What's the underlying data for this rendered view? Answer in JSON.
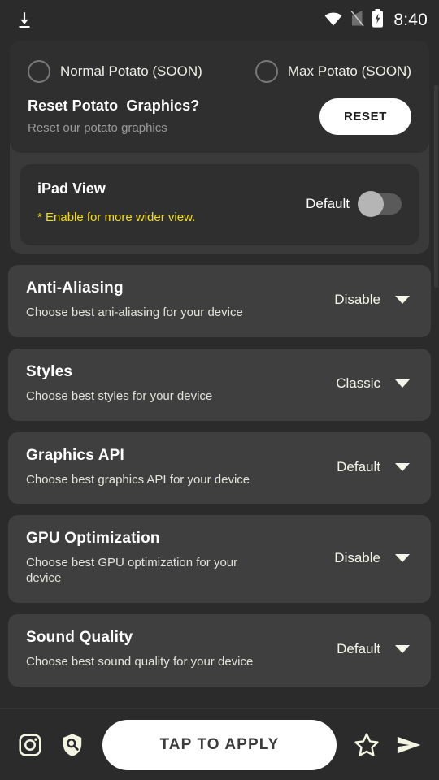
{
  "statusbar": {
    "time": "8:40",
    "icons": [
      "download-icon",
      "wifi-icon",
      "signal-off-icon",
      "battery-charging-icon"
    ]
  },
  "potato_group": {
    "radios": [
      {
        "label": "Normal Potato (SOON)",
        "selected": false
      },
      {
        "label": "Max Potato (SOON)",
        "selected": false
      }
    ],
    "reset": {
      "title": "Reset Potato  Graphics?",
      "subtitle": "Reset our potato graphics",
      "button_label": "RESET"
    }
  },
  "ipad_view": {
    "title": "iPad View",
    "note": "* Enable for more wider view.",
    "note_color": "#f2dd1a",
    "toggle_label": "Default",
    "toggle_on": false
  },
  "settings": [
    {
      "title": "Anti-Aliasing",
      "subtitle": "Choose best ani-aliasing for your device",
      "value": "Disable"
    },
    {
      "title": "Styles",
      "subtitle": "Choose best styles for your device",
      "value": "Classic"
    },
    {
      "title": "Graphics API",
      "subtitle": "Choose best graphics API for your device",
      "value": "Default"
    },
    {
      "title": "GPU Optimization",
      "subtitle": "Choose best GPU optimization for your device",
      "value": "Disable"
    },
    {
      "title": "Sound Quality",
      "subtitle": "Choose best sound quality for your device",
      "value": "Default"
    }
  ],
  "bottombar": {
    "instagram_icon": "instagram-icon",
    "shield_search_icon": "shield-search-icon",
    "apply_label": "TAP TO APPLY",
    "star_icon": "star-outline-icon",
    "send_icon": "send-icon"
  },
  "colors": {
    "page_background": "#2b2b2b",
    "card_background": "#3f3f3f",
    "inner_card_background": "#2f2f2f",
    "group_background": "#3a3a3a",
    "accent_cream": "#f4f4e8",
    "warning_yellow": "#f2dd1a"
  }
}
